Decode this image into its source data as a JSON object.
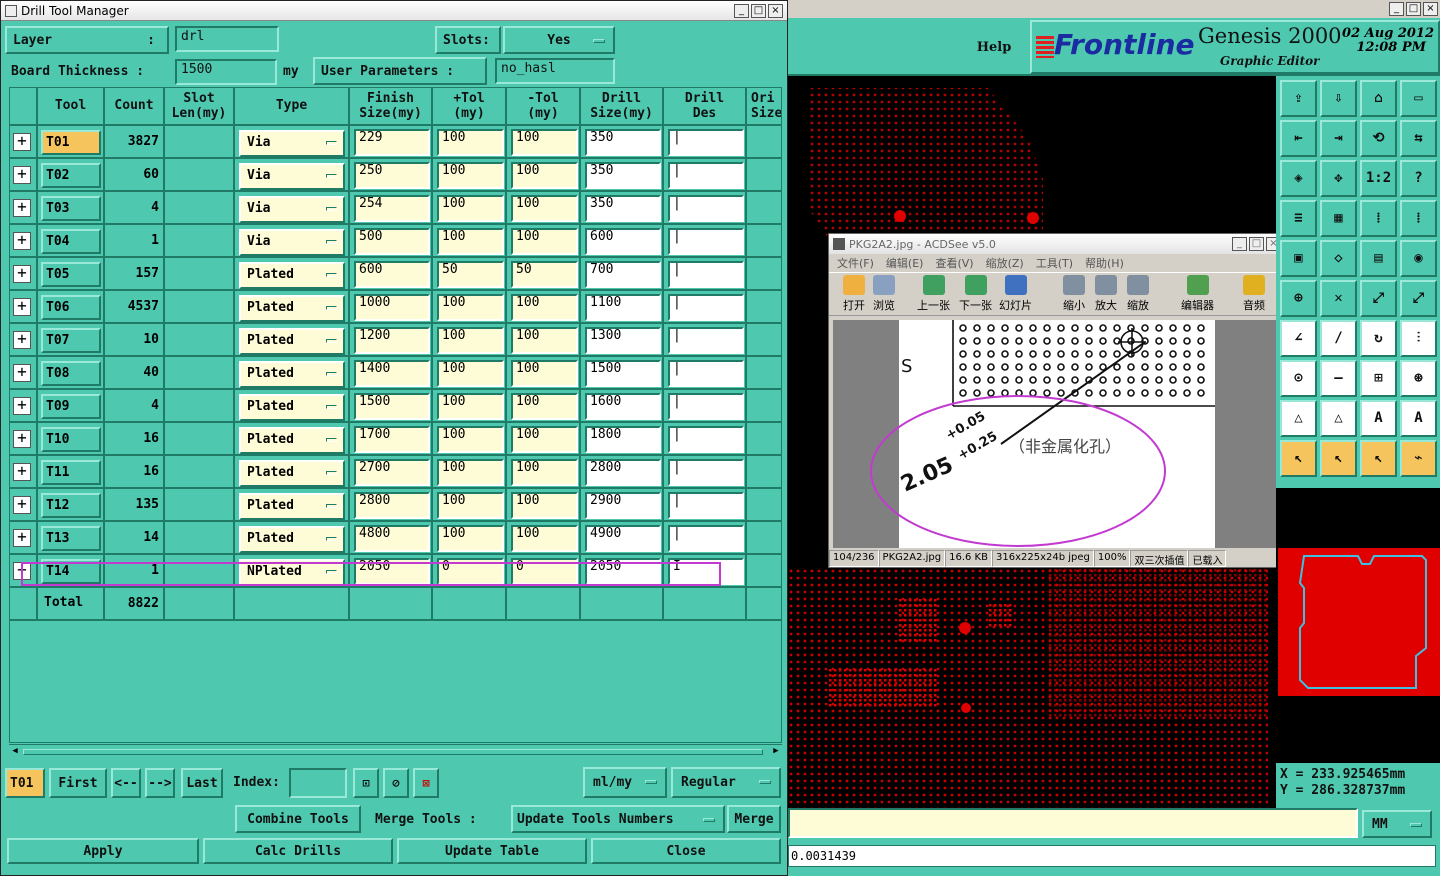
{
  "dtm": {
    "title": "Drill Tool Manager",
    "win_min": "_",
    "win_max": "□",
    "win_close": "×",
    "layer_label": "Layer",
    "layer_colon": ":",
    "layer_value": "drl",
    "slots_label": "Slots:",
    "slots_value": "Yes",
    "board_label": "Board Thickness :",
    "board_value": "1500",
    "board_unit": "my",
    "user_params_label": "User Parameters :",
    "user_params_value": "no_hasl",
    "columns": [
      "Tool",
      "Count",
      "Slot\nLen(my)",
      "Type",
      "Finish\nSize(my)",
      "+Tol\n(my)",
      "-Tol\n(my)",
      "Drill\nSize(my)",
      "Drill\nDes",
      "Ori\nSize"
    ],
    "rows": [
      {
        "tool": "T01",
        "count": "3827",
        "type": "Via",
        "finish": "229",
        "ptol": "100",
        "mtol": "100",
        "drill": "350",
        "des": "|"
      },
      {
        "tool": "T02",
        "count": "60",
        "type": "Via",
        "finish": "250",
        "ptol": "100",
        "mtol": "100",
        "drill": "350",
        "des": "|"
      },
      {
        "tool": "T03",
        "count": "4",
        "type": "Via",
        "finish": "254",
        "ptol": "100",
        "mtol": "100",
        "drill": "350",
        "des": "|"
      },
      {
        "tool": "T04",
        "count": "1",
        "type": "Via",
        "finish": "500",
        "ptol": "100",
        "mtol": "100",
        "drill": "600",
        "des": "|"
      },
      {
        "tool": "T05",
        "count": "157",
        "type": "Plated",
        "finish": "600",
        "ptol": "50",
        "mtol": "50",
        "drill": "700",
        "des": "|"
      },
      {
        "tool": "T06",
        "count": "4537",
        "type": "Plated",
        "finish": "1000",
        "ptol": "100",
        "mtol": "100",
        "drill": "1100",
        "des": "|"
      },
      {
        "tool": "T07",
        "count": "10",
        "type": "Plated",
        "finish": "1200",
        "ptol": "100",
        "mtol": "100",
        "drill": "1300",
        "des": "|"
      },
      {
        "tool": "T08",
        "count": "40",
        "type": "Plated",
        "finish": "1400",
        "ptol": "100",
        "mtol": "100",
        "drill": "1500",
        "des": "|"
      },
      {
        "tool": "T09",
        "count": "4",
        "type": "Plated",
        "finish": "1500",
        "ptol": "100",
        "mtol": "100",
        "drill": "1600",
        "des": "|"
      },
      {
        "tool": "T10",
        "count": "16",
        "type": "Plated",
        "finish": "1700",
        "ptol": "100",
        "mtol": "100",
        "drill": "1800",
        "des": "|"
      },
      {
        "tool": "T11",
        "count": "16",
        "type": "Plated",
        "finish": "2700",
        "ptol": "100",
        "mtol": "100",
        "drill": "2800",
        "des": "|"
      },
      {
        "tool": "T12",
        "count": "135",
        "type": "Plated",
        "finish": "2800",
        "ptol": "100",
        "mtol": "100",
        "drill": "2900",
        "des": "|"
      },
      {
        "tool": "T13",
        "count": "14",
        "type": "Plated",
        "finish": "4800",
        "ptol": "100",
        "mtol": "100",
        "drill": "4900",
        "des": "|"
      },
      {
        "tool": "T14",
        "count": "1",
        "type": "NPlated",
        "finish": "2050",
        "ptol": "0",
        "mtol": "0",
        "drill": "2050",
        "des": "I"
      }
    ],
    "total_label": "Total",
    "total_count": "8822",
    "nav": {
      "current": "T01",
      "first": "First",
      "prev": "<--",
      "next": "-->",
      "last": "Last",
      "index_label": "Index:",
      "units": "ml/my",
      "mode": "Regular"
    },
    "combine": "Combine Tools",
    "merge_label": "Merge Tools :",
    "merge_option": "Update Tools Numbers",
    "merge_btn": "Merge",
    "apply": "Apply",
    "calc": "Calc Drills",
    "update": "Update Table",
    "close": "Close"
  },
  "genesis": {
    "help": "Help",
    "brand": "Frontline",
    "product": "Genesis 2000",
    "subtitle": "Graphic Editor",
    "date": "02 Aug 2012",
    "time": "12:08 PM",
    "coord_x": "X = 233.925465mm",
    "coord_y": "Y = 286.328737mm",
    "units": "MM",
    "status": "0.0031439"
  },
  "acdsee": {
    "title": "PKG2A2.jpg - ACDSee v5.0",
    "menu": [
      "文件(F)",
      "编辑(E)",
      "查看(V)",
      "缩放(Z)",
      "工具(T)",
      "帮助(H)"
    ],
    "toolbar": [
      "打开",
      "浏览",
      "上一张",
      "下一张",
      "幻灯片",
      "缩小",
      "放大",
      "缩放",
      "编辑器",
      "音频"
    ],
    "image_text": {
      "dim": "2.05",
      "tol_plus": "+0.05",
      "tol_plus2": "+0.25",
      "note": "（非金属化孔）"
    },
    "status": [
      "104/236",
      "PKG2A2.jpg",
      "16.6 KB",
      "316x225x24b jpeg",
      "100%",
      "双三次插值",
      "已载入"
    ]
  },
  "colors": {
    "panel": "#4ec9b0",
    "highlight": "#c23ad0",
    "board": "#e00000",
    "selected": "#f6c45c"
  }
}
